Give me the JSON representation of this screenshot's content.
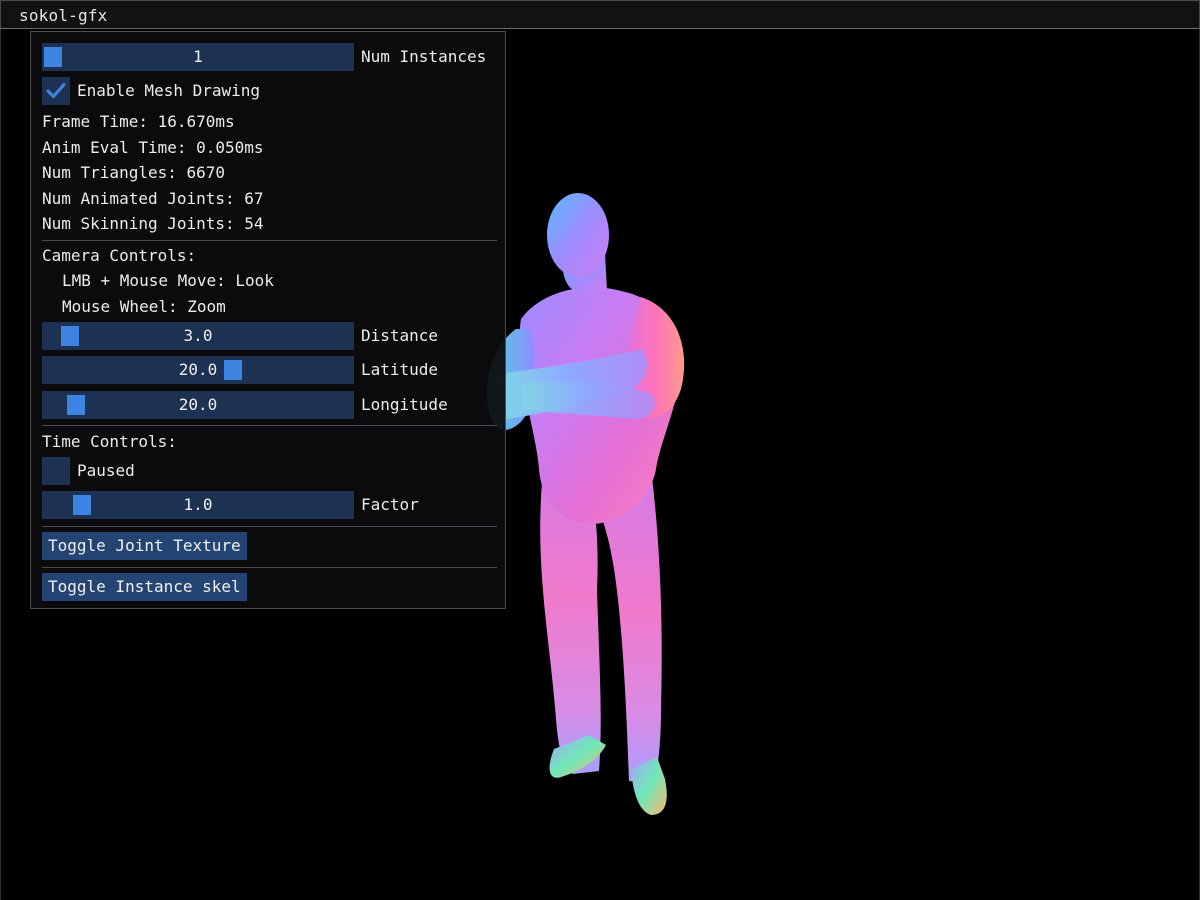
{
  "window": {
    "title": "sokol-gfx"
  },
  "panel": {
    "num_instances": {
      "value": "1",
      "label": "Num Instances",
      "level": 0.0
    },
    "enable_mesh_drawing": {
      "label": "Enable Mesh Drawing",
      "checked": true
    },
    "stats": {
      "frame_time": "Frame Time: 16.670ms",
      "anim_eval_time": "Anim Eval Time: 0.050ms",
      "num_triangles": "Num Triangles: 6670",
      "num_animated_joints": "Num Animated Joints: 67",
      "num_skinning_joints": "Num Skinning Joints: 54"
    },
    "camera": {
      "heading": "Camera Controls:",
      "hint_look": "LMB + Mouse Move: Look",
      "hint_zoom": "Mouse Wheel: Zoom",
      "distance": {
        "value": "3.0",
        "label": "Distance",
        "level": 0.06
      },
      "latitude": {
        "value": "20.0",
        "label": "Latitude",
        "level": 0.62
      },
      "longitude": {
        "value": "20.0",
        "label": "Longitude",
        "level": 0.08
      }
    },
    "time": {
      "heading": "Time Controls:",
      "paused": {
        "label": "Paused",
        "checked": false
      },
      "factor": {
        "value": "1.0",
        "label": "Factor",
        "level": 0.1
      }
    },
    "buttons": {
      "toggle_joint_texture": "Toggle Joint Texture",
      "toggle_instance_skel": "Toggle Instance skel"
    }
  },
  "colors": {
    "slider_bg": "#1d3152",
    "slider_grab": "#3d85e0",
    "button_bg": "#244574",
    "panel_bg": "#0c0c0e"
  }
}
